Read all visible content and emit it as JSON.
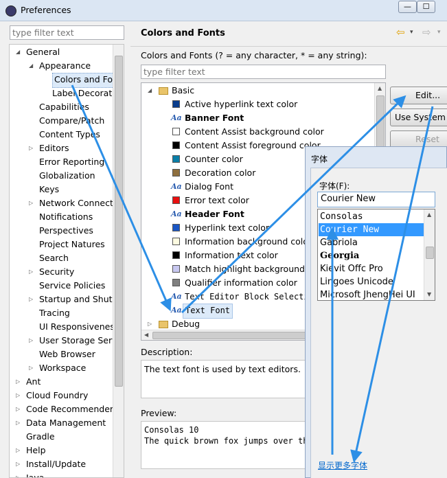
{
  "window": {
    "title": "Preferences",
    "min": "—",
    "max": "☐"
  },
  "sidebar": {
    "filter_placeholder": "type filter text",
    "items": [
      {
        "label": "General",
        "indent": 0,
        "toggle": "open"
      },
      {
        "label": "Appearance",
        "indent": 1,
        "toggle": "open"
      },
      {
        "label": "Colors and Fonts",
        "indent": 2,
        "toggle": "none",
        "selected": true
      },
      {
        "label": "Label Decorations",
        "indent": 2,
        "toggle": "none"
      },
      {
        "label": "Capabilities",
        "indent": 1,
        "toggle": "none"
      },
      {
        "label": "Compare/Patch",
        "indent": 1,
        "toggle": "none"
      },
      {
        "label": "Content Types",
        "indent": 1,
        "toggle": "none"
      },
      {
        "label": "Editors",
        "indent": 1,
        "toggle": "closed"
      },
      {
        "label": "Error Reporting",
        "indent": 1,
        "toggle": "none"
      },
      {
        "label": "Globalization",
        "indent": 1,
        "toggle": "none"
      },
      {
        "label": "Keys",
        "indent": 1,
        "toggle": "none"
      },
      {
        "label": "Network Connections",
        "indent": 1,
        "toggle": "closed"
      },
      {
        "label": "Notifications",
        "indent": 1,
        "toggle": "none"
      },
      {
        "label": "Perspectives",
        "indent": 1,
        "toggle": "none"
      },
      {
        "label": "Project Natures",
        "indent": 1,
        "toggle": "none"
      },
      {
        "label": "Search",
        "indent": 1,
        "toggle": "none"
      },
      {
        "label": "Security",
        "indent": 1,
        "toggle": "closed"
      },
      {
        "label": "Service Policies",
        "indent": 1,
        "toggle": "none"
      },
      {
        "label": "Startup and Shutdown",
        "indent": 1,
        "toggle": "closed"
      },
      {
        "label": "Tracing",
        "indent": 1,
        "toggle": "none"
      },
      {
        "label": "UI Responsiveness",
        "indent": 1,
        "toggle": "none"
      },
      {
        "label": "User Storage Service",
        "indent": 1,
        "toggle": "closed"
      },
      {
        "label": "Web Browser",
        "indent": 1,
        "toggle": "none"
      },
      {
        "label": "Workspace",
        "indent": 1,
        "toggle": "closed"
      },
      {
        "label": "Ant",
        "indent": 0,
        "toggle": "closed"
      },
      {
        "label": "Cloud Foundry",
        "indent": 0,
        "toggle": "closed"
      },
      {
        "label": "Code Recommenders",
        "indent": 0,
        "toggle": "closed"
      },
      {
        "label": "Data Management",
        "indent": 0,
        "toggle": "closed"
      },
      {
        "label": "Gradle",
        "indent": 0,
        "toggle": "none"
      },
      {
        "label": "Help",
        "indent": 0,
        "toggle": "closed"
      },
      {
        "label": "Install/Update",
        "indent": 0,
        "toggle": "closed"
      },
      {
        "label": "Java",
        "indent": 0,
        "toggle": "closed"
      }
    ]
  },
  "main": {
    "title": "Colors and Fonts",
    "nav_back": "⇦",
    "nav_forward": "⇨",
    "nav_menu": "▾",
    "subtitle": "Colors and Fonts (? = any character, * = any string):",
    "filter_placeholder": "type filter text",
    "tree": {
      "groups": [
        {
          "label": "Basic",
          "toggle": "open"
        },
        {
          "label": "Debug",
          "toggle": "closed"
        }
      ],
      "items": [
        {
          "label": "Active hyperlink text color",
          "kind": "color",
          "color": "#0a3d8c"
        },
        {
          "label": "Banner Font",
          "kind": "font",
          "bold": true
        },
        {
          "label": "Content Assist background color",
          "kind": "color",
          "color": "#ffffff"
        },
        {
          "label": "Content Assist foreground color",
          "kind": "color",
          "color": "#000000"
        },
        {
          "label": "Counter color",
          "kind": "color",
          "color": "#0a7fa8"
        },
        {
          "label": "Decoration color",
          "kind": "color",
          "color": "#8e6f3e"
        },
        {
          "label": "Dialog Font",
          "kind": "font"
        },
        {
          "label": "Error text color",
          "kind": "color",
          "color": "#e81010"
        },
        {
          "label": "Header Font",
          "kind": "font",
          "bold": true
        },
        {
          "label": "Hyperlink text color",
          "kind": "color",
          "color": "#1a56c4"
        },
        {
          "label": "Information background color",
          "kind": "color",
          "color": "#fdfbe1"
        },
        {
          "label": "Information text color",
          "kind": "color",
          "color": "#000000"
        },
        {
          "label": "Match highlight background color",
          "kind": "color",
          "color": "#c8c8f0"
        },
        {
          "label": "Qualifier information color",
          "kind": "color",
          "color": "#808080"
        },
        {
          "label": "Text Editor Block Selection Font",
          "kind": "font",
          "mono": true
        },
        {
          "label": "Text Font",
          "kind": "font",
          "mono": true,
          "selected": true
        }
      ]
    },
    "buttons": {
      "edit": "Edit...",
      "use_system": "Use System Font",
      "reset": "Reset"
    },
    "description_label": "Description:",
    "description_text": "The text font is used by text editors.",
    "preview_label": "Preview:",
    "preview_line1": "Consolas 10",
    "preview_line2": "The quick brown fox jumps over the lazy dog."
  },
  "font_dialog": {
    "title": "字体",
    "font_label": "字体(F):",
    "font_value": "Courier New",
    "fonts": [
      {
        "label": "Consolas",
        "family": "mono"
      },
      {
        "label": "Courier New",
        "family": "mono",
        "selected": true
      },
      {
        "label": "Gabriola",
        "family": "sans"
      },
      {
        "label": "Georgia",
        "family": "serif"
      },
      {
        "label": "Kievit Offc Pro",
        "family": "sans"
      },
      {
        "label": "Lingoes Unicode",
        "family": "sans"
      },
      {
        "label": "Microsoft JhengHei UI",
        "family": "sans"
      }
    ],
    "more_fonts_link": "显示更多字体"
  },
  "accent_colors": {
    "selection": "#3399ff",
    "arrow": "#2d8fe6",
    "link": "#0066cc"
  }
}
